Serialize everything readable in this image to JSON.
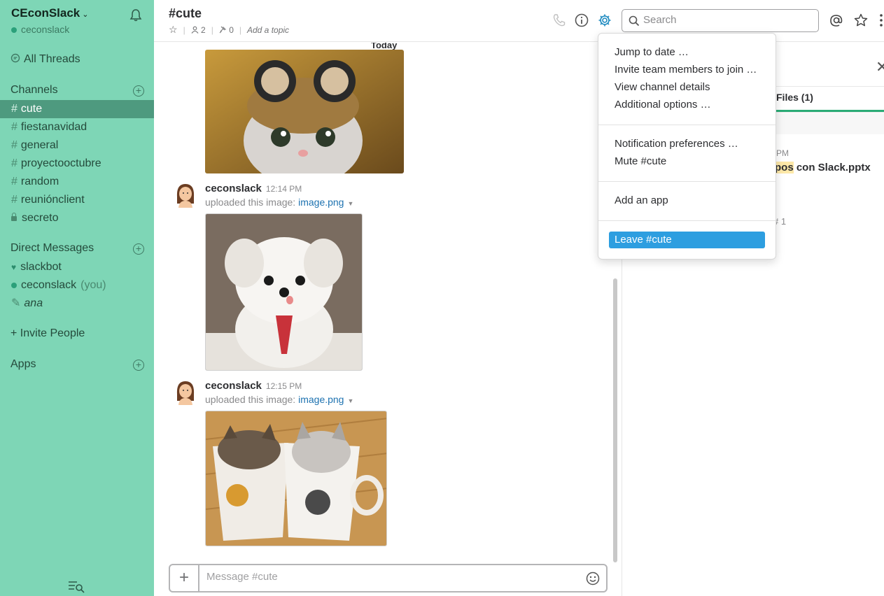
{
  "sidebar": {
    "team_name": "CEconSlack",
    "team_user": "ceconslack",
    "all_threads": "All Threads",
    "channels_title": "Channels",
    "channels": [
      {
        "name": "cute",
        "active": true
      },
      {
        "name": "fiestanavidad"
      },
      {
        "name": "general"
      },
      {
        "name": "proyectooctubre"
      },
      {
        "name": "random"
      },
      {
        "name": "reuniónclient"
      },
      {
        "name": "secreto",
        "private": true
      }
    ],
    "dm_title": "Direct Messages",
    "dms": [
      {
        "name": "slackbot"
      },
      {
        "name": "ceconslack",
        "suffix": "(you)"
      },
      {
        "name": "ana"
      }
    ],
    "invite": "+ Invite People",
    "apps_title": "Apps"
  },
  "header": {
    "channel_title": "#cute",
    "members": "2",
    "pins": "0",
    "topic": "Add a topic",
    "search_placeholder": "Search"
  },
  "messages": {
    "day_divider": "Today",
    "items": [
      {
        "author": "ceconslack",
        "time": "12:14 PM",
        "upload_prefix": "uploaded this image:",
        "file": "image.png"
      },
      {
        "author": "ceconslack",
        "time": "12:15 PM",
        "upload_prefix": "uploaded this image:",
        "file": "image.png"
      }
    ],
    "composer_placeholder": "Message #cute"
  },
  "right_panel": {
    "tab_files": "Files (1)",
    "time_partial": "PM",
    "file_partial_highlight": "pos",
    "file_partial_rest": " con Slack.pptx",
    "count_partial": "1"
  },
  "menu": {
    "items_group1": [
      "Jump to date …",
      "Invite team members to join …",
      "View channel details",
      "Additional options …"
    ],
    "items_group2": [
      "Notification preferences …",
      "Mute #cute"
    ],
    "items_group3": [
      "Add an app"
    ],
    "leave": "Leave #cute"
  },
  "colors": {
    "sidebar_bg": "#7ed6b6",
    "sidebar_active": "#4e9a7f",
    "link": "#1d72b0",
    "menu_highlight": "#2d9ee0",
    "files_tab_underline": "#2bac76"
  }
}
